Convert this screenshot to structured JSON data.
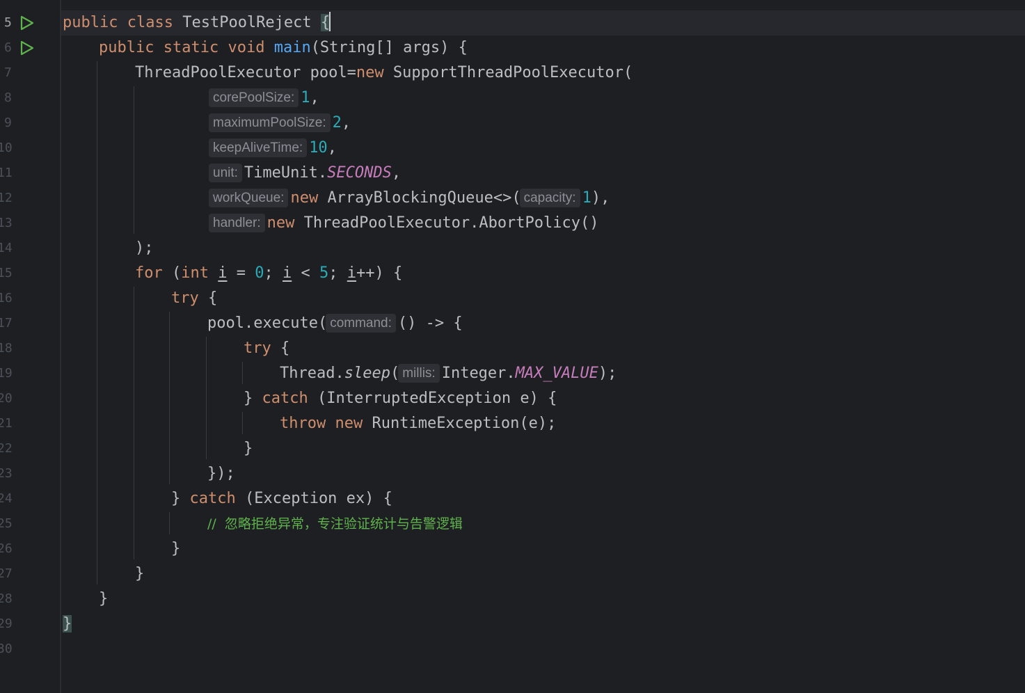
{
  "editor": {
    "line_numbers": [
      "5",
      "6",
      "7",
      "8",
      "9",
      "10",
      "11",
      "12",
      "13",
      "14",
      "15",
      "16",
      "17",
      "18",
      "19",
      "20",
      "21",
      "22",
      "23",
      "24",
      "25",
      "26",
      "27",
      "28",
      "29",
      "30"
    ],
    "current_line": "5",
    "gutter_icons": [
      "run-icon",
      "run-icon"
    ]
  },
  "code": {
    "l5": {
      "public": "public",
      "class": "class",
      "name": "TestPoolReject",
      "brace": "{"
    },
    "l6": {
      "public": "public",
      "static": "static",
      "void": "void",
      "main": "main",
      "rest": "(String[] args) {"
    },
    "l7": {
      "type": "ThreadPoolExecutor pool=",
      "new": "new",
      "rest": " SupportThreadPoolExecutor("
    },
    "l8": {
      "hint": "corePoolSize:",
      "num": "1",
      "tail": ","
    },
    "l9": {
      "hint": "maximumPoolSize:",
      "num": "2",
      "tail": ","
    },
    "l10": {
      "hint": "keepAliveTime:",
      "num": "10",
      "tail": ","
    },
    "l11": {
      "hint": "unit:",
      "cls": "TimeUnit.",
      "const": "SECONDS",
      "tail": ","
    },
    "l12": {
      "hint": "workQueue:",
      "new": "new",
      "cls": " ArrayBlockingQueue<>(",
      "hint2": "capacity:",
      "num": "1",
      "tail": "),"
    },
    "l13": {
      "hint": "handler:",
      "new": "new",
      "rest": " ThreadPoolExecutor.AbortPolicy()"
    },
    "l14": {
      "text": ");"
    },
    "l15": {
      "for": "for",
      "p1": " (",
      "int": "int",
      "i1": "i",
      "p2": " = ",
      "n0": "0",
      "p3": "; ",
      "i2": "i",
      "p4": " < ",
      "n5": "5",
      "p5": "; ",
      "i3": "i",
      "p6": "++) {"
    },
    "l16": {
      "try": "try",
      "rest": " {"
    },
    "l17": {
      "call": "pool.execute(",
      "hint": "command:",
      "rest": "() -> {"
    },
    "l18": {
      "try": "try",
      "rest": " {"
    },
    "l19": {
      "cls": "Thread.",
      "method": "sleep",
      "p": "(",
      "hint": "millis:",
      "cls2": "Integer.",
      "const": "MAX_VALUE",
      "tail": ");"
    },
    "l20": {
      "close": "} ",
      "catch": "catch",
      "rest": " (InterruptedException e) {"
    },
    "l21": {
      "throw": "throw",
      "sp": " ",
      "new": "new",
      "rest": " RuntimeException(e);"
    },
    "l22": {
      "text": "}"
    },
    "l23": {
      "text": "});"
    },
    "l24": {
      "close": "} ",
      "catch": "catch",
      "rest": " (Exception ex) {"
    },
    "l25": {
      "comment": "//  忽略拒绝异常，专注验证统计与告警逻辑"
    },
    "l26": {
      "text": "}"
    },
    "l27": {
      "text": "}"
    },
    "l28": {
      "text": "}"
    },
    "l29": {
      "text": "}"
    }
  }
}
